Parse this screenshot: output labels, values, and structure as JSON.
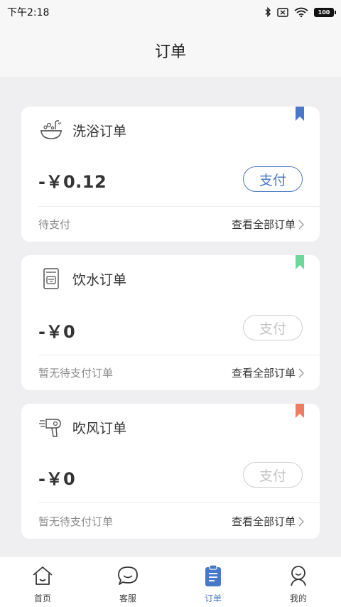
{
  "status_bar": {
    "time": "下午2:18",
    "battery": "100"
  },
  "header": {
    "title": "订单"
  },
  "cards": [
    {
      "title": "洗浴订单",
      "icon": "bath-icon",
      "bookmark_color": "#4a78c8",
      "amount": "-￥0.12",
      "pay_label": "支付",
      "pay_enabled": true,
      "status": "待支付",
      "view_all": "查看全部订单"
    },
    {
      "title": "饮水订单",
      "icon": "water-dispenser-icon",
      "bookmark_color": "#6fd79b",
      "amount": "-￥0",
      "pay_label": "支付",
      "pay_enabled": false,
      "status": "暂无待支付订单",
      "view_all": "查看全部订单"
    },
    {
      "title": "吹风订单",
      "icon": "hair-dryer-icon",
      "bookmark_color": "#ef7b63",
      "amount": "-￥0",
      "pay_label": "支付",
      "pay_enabled": false,
      "status": "暂无待支付订单",
      "view_all": "查看全部订单"
    }
  ],
  "bottom_nav": [
    {
      "label": "首页",
      "icon": "home-icon",
      "active": false
    },
    {
      "label": "客服",
      "icon": "customer-service-icon",
      "active": false
    },
    {
      "label": "订单",
      "icon": "orders-icon",
      "active": true
    },
    {
      "label": "我的",
      "icon": "profile-icon",
      "active": false
    }
  ],
  "colors": {
    "accent": "#4a78c8",
    "background": "#efeff1"
  }
}
